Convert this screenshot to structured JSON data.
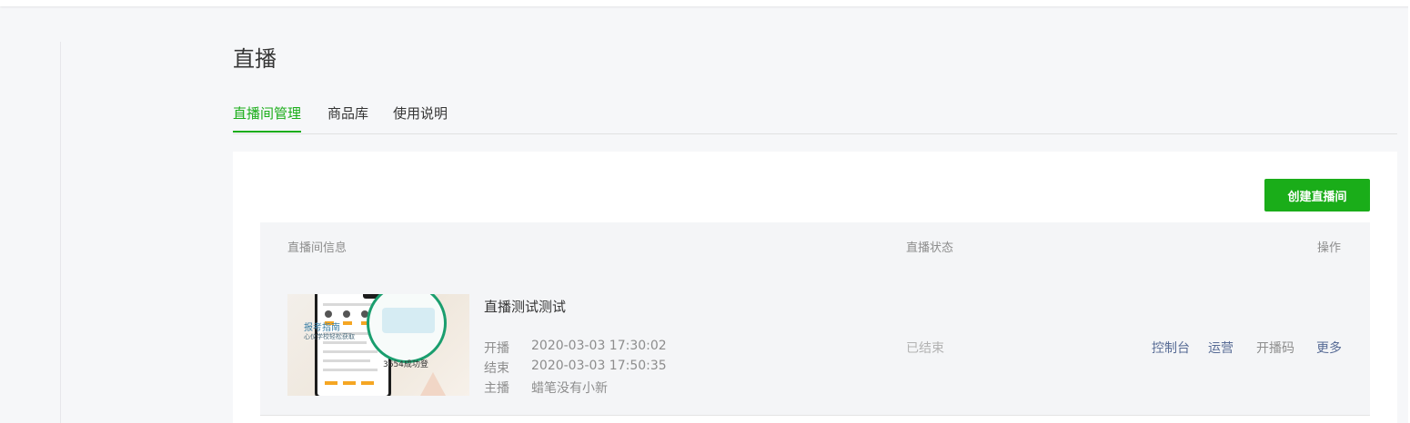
{
  "page": {
    "title": "直播"
  },
  "tabs": [
    {
      "label": "直播间管理",
      "active": true
    },
    {
      "label": "商品库",
      "active": false
    },
    {
      "label": "使用说明",
      "active": false
    }
  ],
  "actions": {
    "create_label": "创建直播间"
  },
  "table": {
    "headers": {
      "info": "直播间信息",
      "status": "直播状态",
      "ops": "操作"
    },
    "rows": [
      {
        "name": "直播测试测试",
        "start_label": "开播",
        "start_value": "2020-03-03 17:30:02",
        "end_label": "结束",
        "end_value": "2020-03-03 17:50:35",
        "host_label": "主播",
        "host_value": "蜡笔没有小新",
        "status": "已结束",
        "ops": [
          "控制台",
          "运营",
          "开播码",
          "更多"
        ],
        "thumbnail": {
          "title": "报考指南",
          "subtitle": "心仪学校轻松获取",
          "footer": "3654成功登"
        }
      }
    ]
  },
  "colors": {
    "accent": "#1aad19",
    "link": "#576b95",
    "muted": "#8d8d8d",
    "status_ended": "#b2b2b2",
    "background": "#f6f7f9"
  }
}
